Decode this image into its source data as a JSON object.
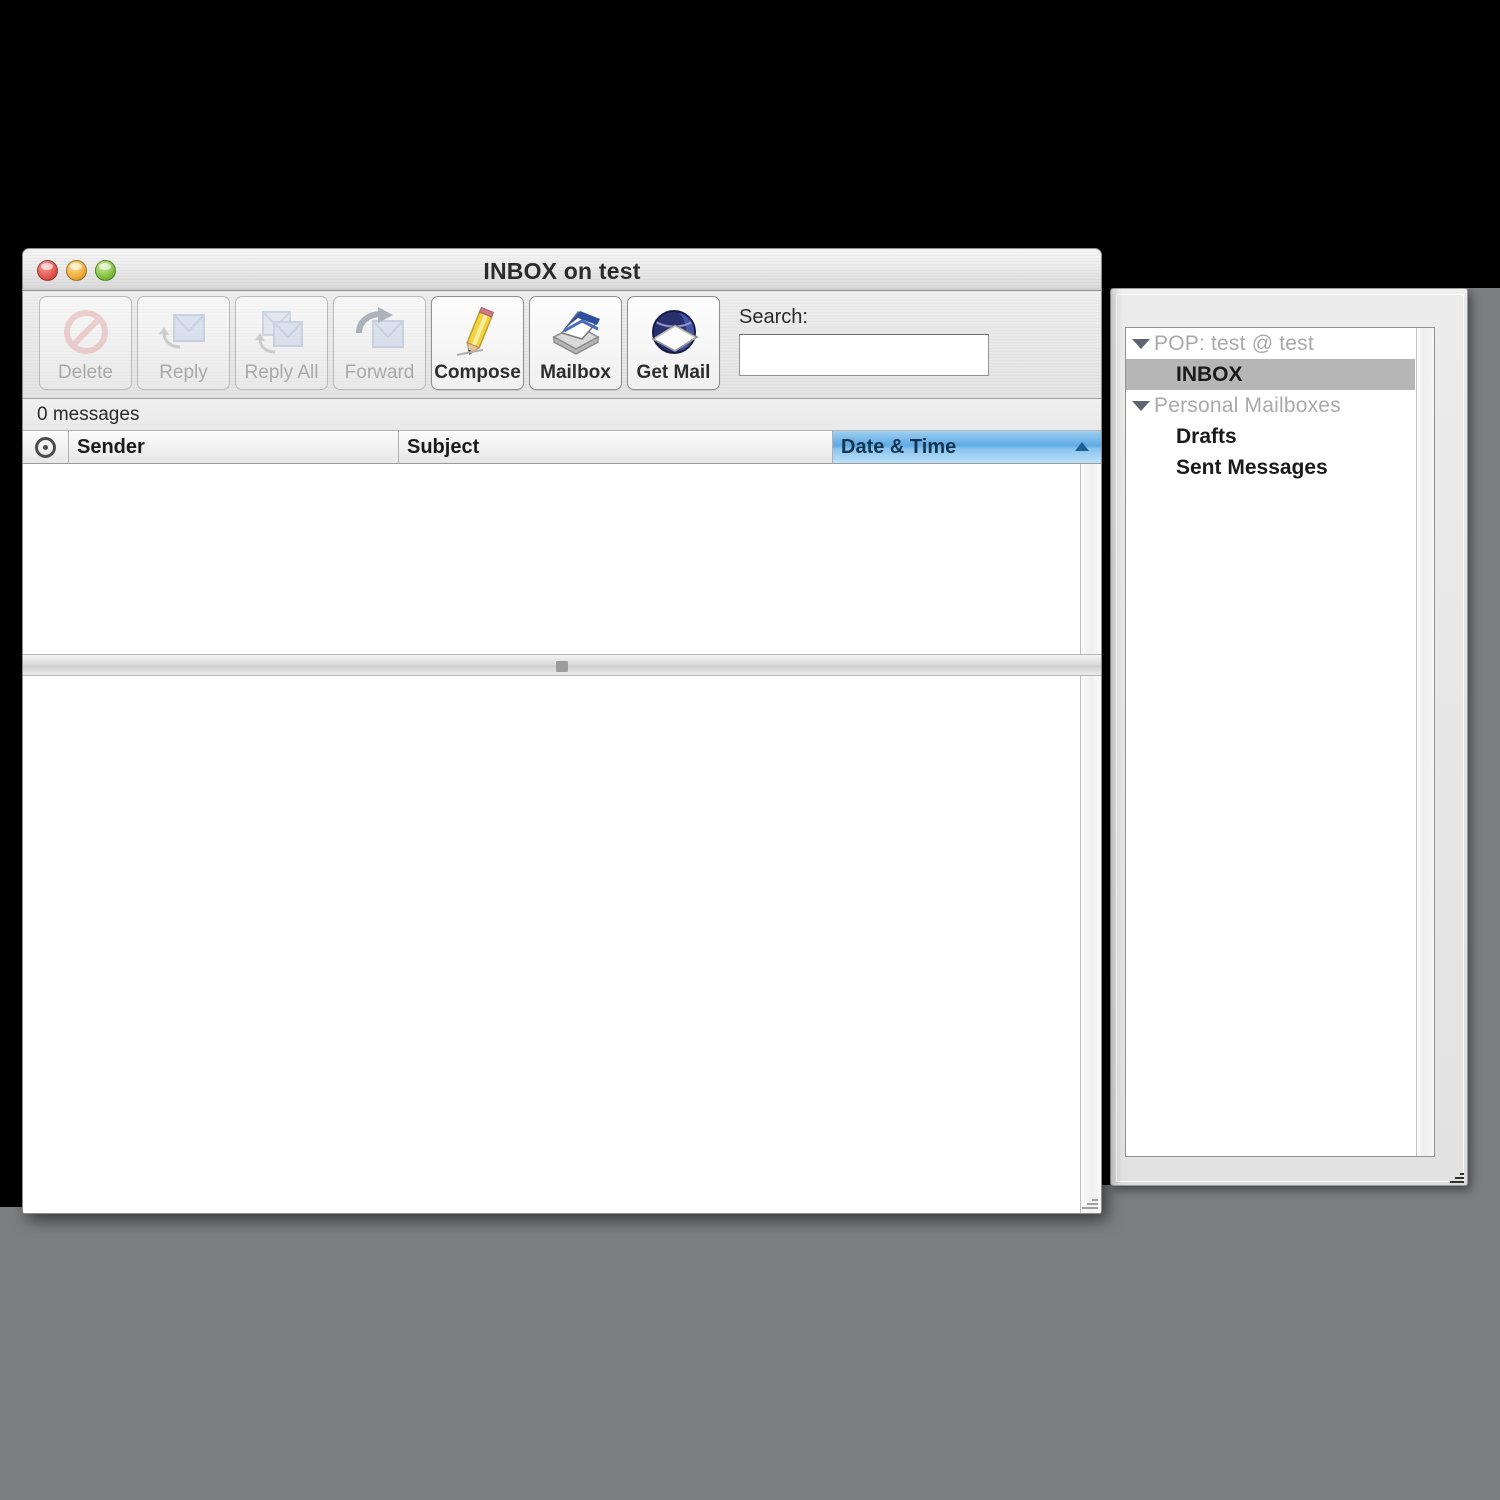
{
  "window": {
    "title": "INBOX on test",
    "traffic_lights": [
      "close-button",
      "minimize-button",
      "zoom-button"
    ]
  },
  "toolbar": {
    "buttons": [
      {
        "label": "Delete",
        "icon": "prohibited-sign-icon",
        "enabled": false
      },
      {
        "label": "Reply",
        "icon": "reply-letter-icon",
        "enabled": false
      },
      {
        "label": "Reply All",
        "icon": "reply-all-letters-icon",
        "enabled": false
      },
      {
        "label": "Forward",
        "icon": "forward-arrow-letter-icon",
        "enabled": false
      },
      {
        "label": "Compose",
        "icon": "pencil-icon",
        "enabled": true
      },
      {
        "label": "Mailbox",
        "icon": "mail-tray-icon",
        "enabled": true
      },
      {
        "label": "Get Mail",
        "icon": "globe-letter-icon",
        "enabled": true
      }
    ]
  },
  "search": {
    "label": "Search:",
    "value": "",
    "placeholder": ""
  },
  "status": {
    "message_count_text": "0 messages"
  },
  "message_list": {
    "columns": [
      {
        "id": "flag",
        "label": "",
        "icon": "status-circle-icon",
        "sorted": false
      },
      {
        "id": "sender",
        "label": "Sender",
        "sorted": false
      },
      {
        "id": "subject",
        "label": "Subject",
        "sorted": false
      },
      {
        "id": "date",
        "label": "Date & Time",
        "sorted": true,
        "sort_direction": "ascending"
      }
    ],
    "rows": []
  },
  "sidebar": {
    "items": [
      {
        "label": "POP: test @ test",
        "type": "group",
        "expanded": true,
        "selected": false
      },
      {
        "label": "INBOX",
        "type": "leaf",
        "selected": true
      },
      {
        "label": "Personal Mailboxes",
        "type": "group",
        "expanded": true,
        "selected": false
      },
      {
        "label": "Drafts",
        "type": "leaf",
        "selected": false
      },
      {
        "label": "Sent Messages",
        "type": "leaf",
        "selected": false
      }
    ]
  },
  "colors": {
    "desktop": "#7d7e80",
    "sort_header_accent": "#5fa9e4",
    "selection_gray": "#b6b6b6",
    "window_chrome": "#ebebeb"
  }
}
